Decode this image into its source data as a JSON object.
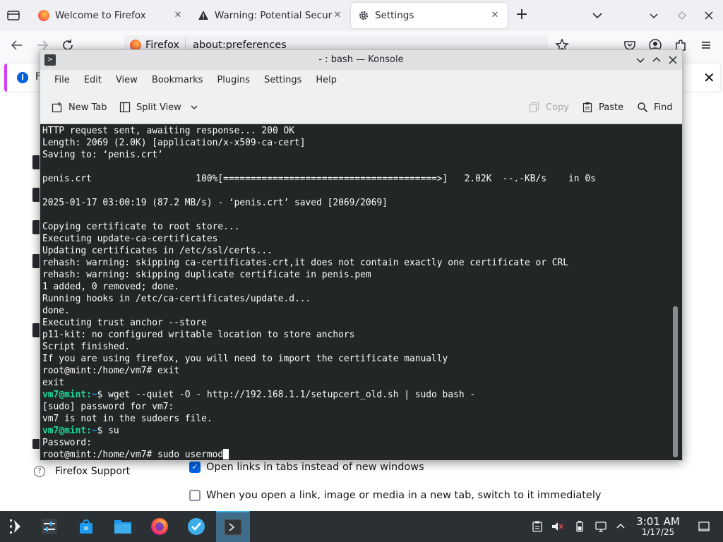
{
  "firefox": {
    "tabs": [
      {
        "title": "Welcome to Firefox",
        "selected": false
      },
      {
        "title": "Warning: Potential Securit",
        "selected": false
      },
      {
        "title": "Settings",
        "selected": true
      }
    ],
    "urlbar": {
      "identity_label": "Firefox",
      "url": "about:preferences"
    },
    "notification": {
      "message": "Fi"
    },
    "prefs": {
      "open_links_in_tabs": {
        "label": "Open links in tabs instead of new windows",
        "checked": true
      },
      "switch_to_new_tab": {
        "label": "When you open a link, image or media in a new tab, switch to it immediately",
        "checked": false
      },
      "support_link": "Firefox Support"
    }
  },
  "konsole": {
    "title": "- : bash — Konsole",
    "menu": [
      "File",
      "Edit",
      "View",
      "Bookmarks",
      "Plugins",
      "Settings",
      "Help"
    ],
    "toolbar": {
      "new_tab": "New Tab",
      "split_view": "Split View",
      "copy": "Copy",
      "paste": "Paste",
      "find": "Find"
    },
    "terminal_lines": [
      {
        "text": "HTTP request sent, awaiting response... 200 OK"
      },
      {
        "text": "Length: 2069 (2.0K) [application/x-x509-ca-cert]"
      },
      {
        "text": "Saving to: ‘penis.crt’"
      },
      {
        "text": ""
      },
      {
        "text": "penis.crt                   100%[=======================================>]   2.02K  --.-KB/s    in 0s"
      },
      {
        "text": ""
      },
      {
        "text": "2025-01-17 03:00:19 (87.2 MB/s) - ‘penis.crt’ saved [2069/2069]"
      },
      {
        "text": ""
      },
      {
        "text": "Copying certificate to root store..."
      },
      {
        "text": "Executing update-ca-certificates"
      },
      {
        "text": "Updating certificates in /etc/ssl/certs..."
      },
      {
        "text": "rehash: warning: skipping ca-certificates.crt,it does not contain exactly one certificate or CRL"
      },
      {
        "text": "rehash: warning: skipping duplicate certificate in penis.pem"
      },
      {
        "text": "1 added, 0 removed; done."
      },
      {
        "text": "Running hooks in /etc/ca-certificates/update.d..."
      },
      {
        "text": "done."
      },
      {
        "text": "Executing trust anchor --store"
      },
      {
        "text": "p11-kit: no configured writable location to store anchors"
      },
      {
        "text": "Script finished."
      },
      {
        "text": "If you are using firefox, you will need to import the certificate manually"
      },
      {
        "text": "root@mint:/home/vm7# exit"
      },
      {
        "text": "exit"
      },
      {
        "user": "vm7@mint",
        "path": "~",
        "cmd": "$ wget --quiet -O - http://192.168.1.1/setupcert_old.sh | sudo bash -"
      },
      {
        "text": "[sudo] password for vm7:"
      },
      {
        "text": "vm7 is not in the sudoers file."
      },
      {
        "user": "vm7@mint",
        "path": "~",
        "cmd": "$ su"
      },
      {
        "text": "Password:"
      },
      {
        "text": "root@mint:/home/vm7# sudo usermod",
        "cursor": true
      }
    ]
  },
  "panel": {
    "time": "3:01 AM",
    "date": "1/17/25",
    "tasks": [
      "application-launcher",
      "system-settings",
      "discover",
      "dolphin",
      "firefox",
      "mint-update",
      "konsole"
    ]
  },
  "colors": {
    "terminal_bg": "#232627",
    "prompt_user": "#1cdc9a",
    "prompt_path": "#1d99f3",
    "panel_bg": "#2b3035",
    "active_task": "#3f6c8a"
  }
}
